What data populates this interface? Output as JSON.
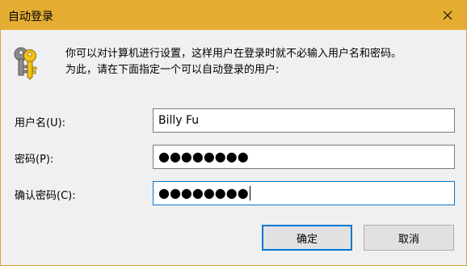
{
  "window": {
    "title": "自动登录",
    "title_bar_color": "#e4ad32"
  },
  "description": {
    "line1": "你可以对计算机进行设置，这样用户在登录时就不必输入用户名和密码。",
    "line2": "为此，请在下面指定一个可以自动登录的用户:"
  },
  "fields": {
    "username": {
      "label": "用户名(U):",
      "value": "Billy Fu"
    },
    "password": {
      "label": "密码(P):",
      "value": "●●●●●●●●"
    },
    "confirm_password": {
      "label": "确认密码(C):",
      "value": "●●●●●●●●"
    }
  },
  "buttons": {
    "ok_label": "确定",
    "cancel_label": "取消"
  },
  "icons": {
    "keys": "keys-icon",
    "close": "close-icon"
  },
  "colors": {
    "accent": "#0078d7"
  }
}
